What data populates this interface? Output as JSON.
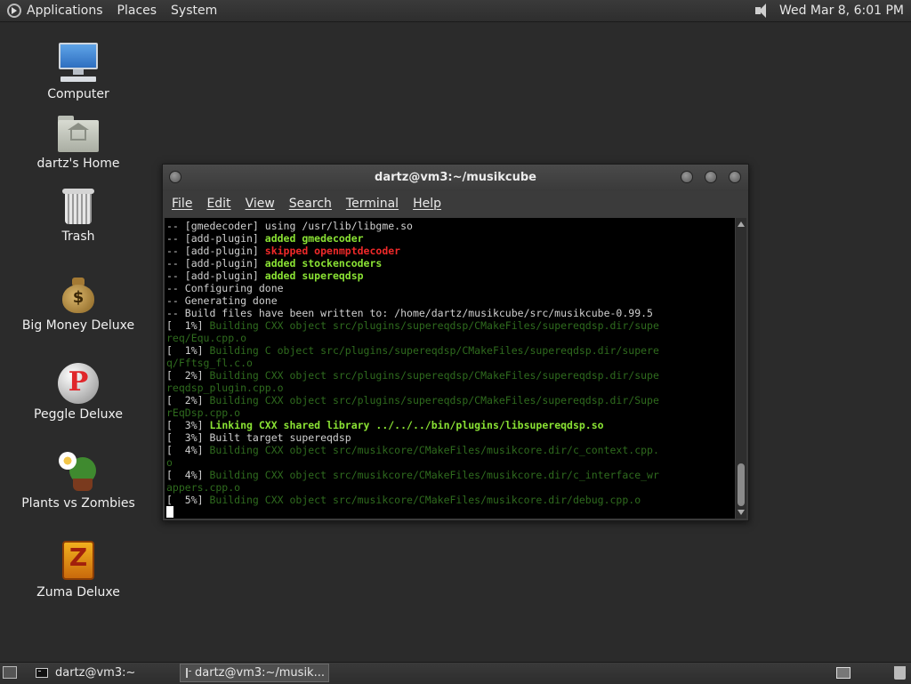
{
  "top_panel": {
    "menus": [
      "Applications",
      "Places",
      "System"
    ],
    "clock": "Wed Mar  8,  6:01 PM"
  },
  "desktop": {
    "icons": [
      {
        "label": "Computer"
      },
      {
        "label": "dartz's Home"
      },
      {
        "label": "Trash"
      },
      {
        "label": "Big Money Deluxe"
      },
      {
        "label": "Peggle Deluxe"
      },
      {
        "label": "Plants vs Zombies"
      },
      {
        "label": "Zuma Deluxe"
      }
    ]
  },
  "window": {
    "title": "dartz@vm3:~/musikcube",
    "menu": [
      "File",
      "Edit",
      "View",
      "Search",
      "Terminal",
      "Help"
    ]
  },
  "terminal": {
    "lines": [
      [
        {
          "t": "-- [gmedecoder] using /usr/lib/libgme.so"
        }
      ],
      [
        {
          "t": "-- [add-plugin] "
        },
        {
          "t": "added gmedecoder",
          "c": "g"
        }
      ],
      [
        {
          "t": "-- [add-plugin] "
        },
        {
          "t": "skipped openmptdecoder",
          "c": "r"
        }
      ],
      [
        {
          "t": "-- [add-plugin] "
        },
        {
          "t": "added stockencoders",
          "c": "g"
        }
      ],
      [
        {
          "t": "-- [add-plugin] "
        },
        {
          "t": "added supereqdsp",
          "c": "g"
        }
      ],
      [
        {
          "t": "-- Configuring done"
        }
      ],
      [
        {
          "t": "-- Generating done"
        }
      ],
      [
        {
          "t": "-- Build files have been written to: /home/dartz/musikcube/src/musikcube-0.99.5"
        }
      ],
      [
        {
          "t": "[  1%] "
        },
        {
          "t": "Building CXX object src/plugins/supereqdsp/CMakeFiles/supereqdsp.dir/supe",
          "c": "dg"
        }
      ],
      [
        {
          "t": "req/Equ.cpp.o",
          "c": "dg"
        }
      ],
      [
        {
          "t": "[  1%] "
        },
        {
          "t": "Building C object src/plugins/supereqdsp/CMakeFiles/supereqdsp.dir/supere",
          "c": "dg"
        }
      ],
      [
        {
          "t": "q/Fftsg_fl.c.o",
          "c": "dg"
        }
      ],
      [
        {
          "t": "[  2%] "
        },
        {
          "t": "Building CXX object src/plugins/supereqdsp/CMakeFiles/supereqdsp.dir/supe",
          "c": "dg"
        }
      ],
      [
        {
          "t": "reqdsp_plugin.cpp.o",
          "c": "dg"
        }
      ],
      [
        {
          "t": "[  2%] "
        },
        {
          "t": "Building CXX object src/plugins/supereqdsp/CMakeFiles/supereqdsp.dir/Supe",
          "c": "dg"
        }
      ],
      [
        {
          "t": "rEqDsp.cpp.o",
          "c": "dg"
        }
      ],
      [
        {
          "t": "[  3%] "
        },
        {
          "t": "Linking CXX shared library ../../../bin/plugins/libsupereqdsp.so",
          "c": "g"
        }
      ],
      [
        {
          "t": "[  3%] Built target supereqdsp"
        }
      ],
      [
        {
          "t": "[  4%] "
        },
        {
          "t": "Building CXX object src/musikcore/CMakeFiles/musikcore.dir/c_context.cpp.",
          "c": "dg"
        }
      ],
      [
        {
          "t": "o",
          "c": "dg"
        }
      ],
      [
        {
          "t": "[  4%] "
        },
        {
          "t": "Building CXX object src/musikcore/CMakeFiles/musikcore.dir/c_interface_wr",
          "c": "dg"
        }
      ],
      [
        {
          "t": "appers.cpp.o",
          "c": "dg"
        }
      ],
      [
        {
          "t": "[  5%] "
        },
        {
          "t": "Building CXX object src/musikcore/CMakeFiles/musikcore.dir/debug.cpp.o",
          "c": "dg"
        }
      ]
    ]
  },
  "taskbar": {
    "tasks": [
      {
        "label": "dartz@vm3:~",
        "active": false
      },
      {
        "label": "dartz@vm3:~/musik...",
        "active": true
      }
    ]
  },
  "icons": {
    "logo": "gnome-foot-icon",
    "volume": "speaker-icon",
    "show_desktop": "show-desktop-icon",
    "workspace": "workspace-icon",
    "trash_applet": "trash-small-icon"
  }
}
